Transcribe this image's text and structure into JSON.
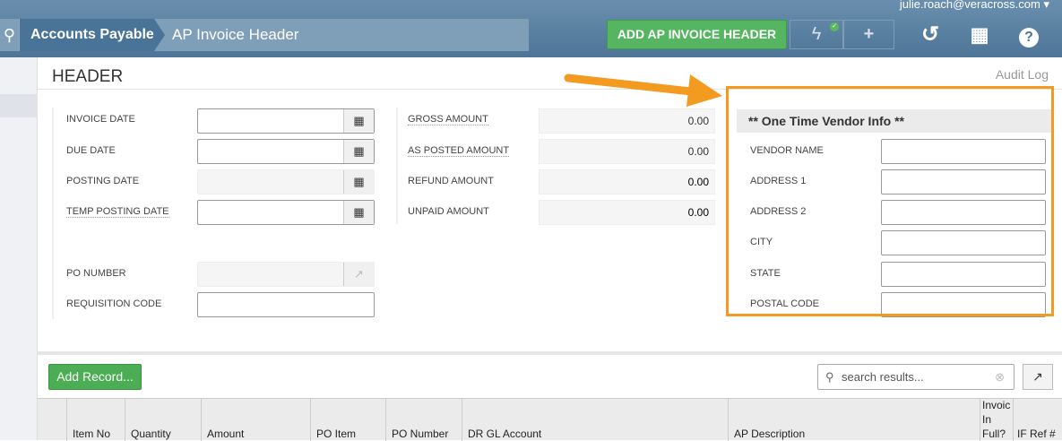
{
  "user": {
    "email": "julie.roach@veracross.com"
  },
  "breadcrumb": {
    "parent": "Accounts Payable",
    "current": "AP Invoice Header"
  },
  "toolbar": {
    "add_label": "ADD AP INVOICE HEADER"
  },
  "section": {
    "title": "HEADER",
    "audit_log": "Audit Log"
  },
  "fields_left": [
    {
      "label": "INVOICE DATE",
      "value": ""
    },
    {
      "label": "DUE DATE",
      "value": ""
    },
    {
      "label": "POSTING DATE",
      "value": ""
    },
    {
      "label": "TEMP POSTING DATE",
      "value": ""
    },
    {
      "label": "PO NUMBER",
      "value": ""
    },
    {
      "label": "REQUISITION CODE",
      "value": ""
    }
  ],
  "amounts": [
    {
      "label": "GROSS AMOUNT",
      "value": "0.00"
    },
    {
      "label": "AS POSTED AMOUNT",
      "value": "0.00"
    },
    {
      "label": "REFUND AMOUNT",
      "value": "0.00"
    },
    {
      "label": "UNPAID AMOUNT",
      "value": "0.00"
    }
  ],
  "vendor": {
    "title": "** One Time Vendor Info **",
    "fields": [
      {
        "label": "VENDOR NAME"
      },
      {
        "label": "ADDRESS 1"
      },
      {
        "label": "ADDRESS 2"
      },
      {
        "label": "CITY"
      },
      {
        "label": "STATE"
      },
      {
        "label": "POSTAL CODE"
      }
    ]
  },
  "grid": {
    "add_record": "Add Record...",
    "search_placeholder": "search results...",
    "columns": [
      "Item No",
      "Quantity",
      "Amount",
      "PO Item",
      "PO Number",
      "DR GL Account",
      "AP Description",
      "Invoic In Full?",
      "IF Ref #"
    ]
  },
  "colors": {
    "accent_green": "#55b560",
    "highlight_orange": "#f39a21",
    "nav_blue": "#4e7597"
  }
}
